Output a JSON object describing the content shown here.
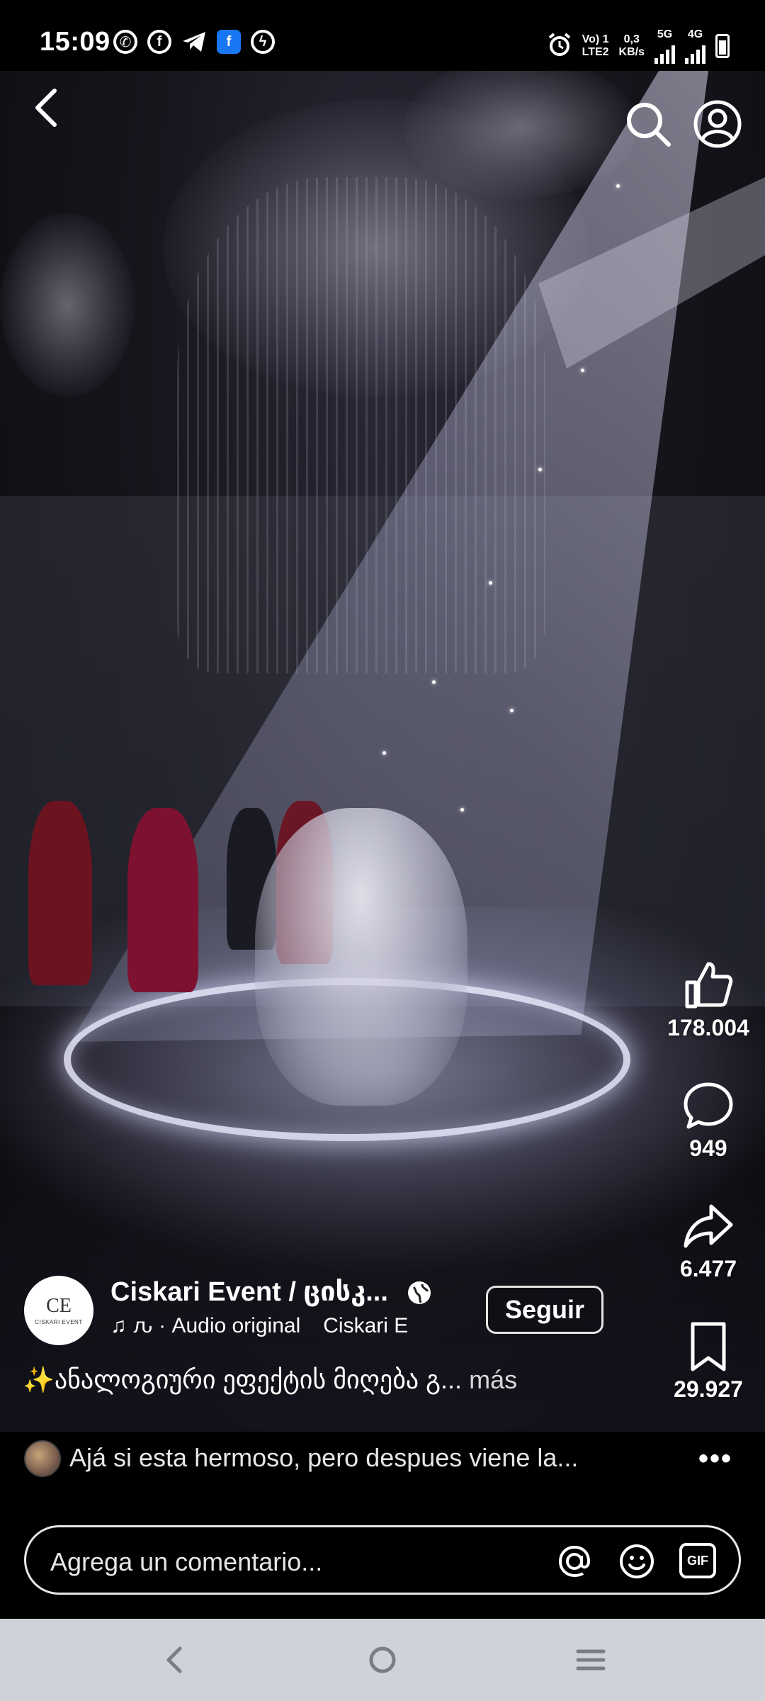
{
  "status_bar": {
    "time": "15:09",
    "network_left": "Vo) 1",
    "network_left_sub": "LTE2",
    "speed": "0,3",
    "speed_unit": "KB/s",
    "net1": "5G",
    "net2": "4G",
    "apps": [
      "whatsapp-icon",
      "facebook-icon",
      "telegram-icon",
      "facebook-square-icon",
      "messenger-icon"
    ]
  },
  "top_controls": {
    "back": "back-arrow-icon",
    "search": "search-icon",
    "profile": "profile-icon"
  },
  "actions": {
    "likes": "178.004",
    "comments": "949",
    "shares": "6.477",
    "saves": "29.927"
  },
  "author": {
    "name": "Ciskari Event / ცისკ...",
    "avatar_initials": "CE",
    "avatar_subtitle": "CISKARI EVENT",
    "audio_prefix": "ԉ · Audio original",
    "audio_credit": "Ciskari E",
    "follow_label": "Seguir"
  },
  "caption": {
    "text": "✨ანალოგიური ეფექტის მიღება გ...",
    "more_label": "más"
  },
  "top_comment": {
    "text": "Ajá si esta hermoso, pero despues viene la..."
  },
  "comment_input": {
    "placeholder": "Agrega un comentario...",
    "gif_label": "GIF"
  },
  "colors": {
    "background": "#000000",
    "navbar": "#cfd2d8",
    "facebook": "#1877f2"
  }
}
